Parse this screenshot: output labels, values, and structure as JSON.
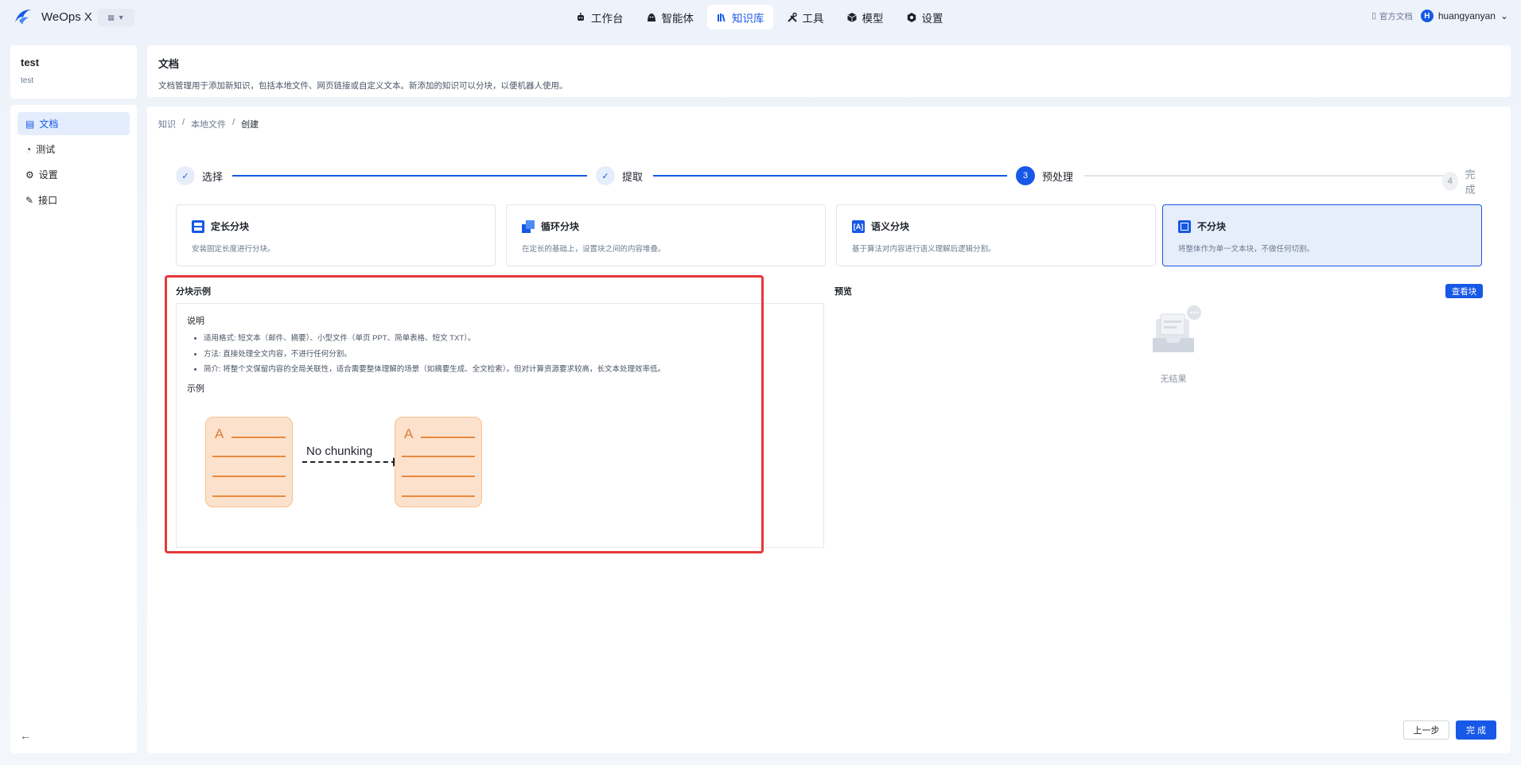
{
  "app": {
    "name": "WeOps X"
  },
  "nav": [
    {
      "label": "工作台",
      "icon": "robot-icon"
    },
    {
      "label": "智能体",
      "icon": "agent-icon"
    },
    {
      "label": "知识库",
      "icon": "library-icon",
      "active": true
    },
    {
      "label": "工具",
      "icon": "tools-icon"
    },
    {
      "label": "模型",
      "icon": "model-icon"
    },
    {
      "label": "设置",
      "icon": "gear-icon"
    }
  ],
  "topright": {
    "docs_label": "官方文档",
    "avatar_letter": "H",
    "username": "huangyanyan"
  },
  "sidebar": {
    "title": "test",
    "subtitle": "test",
    "items": [
      {
        "label": "文档",
        "icon": "document-icon",
        "active": true
      },
      {
        "label": "测试",
        "icon": "test-icon"
      },
      {
        "label": "设置",
        "icon": "settings-icon"
      },
      {
        "label": "接口",
        "icon": "api-icon"
      }
    ]
  },
  "header": {
    "title": "文档",
    "description": "文档管理用于添加新知识，包括本地文件、网页链接或自定义文本。新添加的知识可以分块，以便机器人使用。"
  },
  "breadcrumb": {
    "items": [
      "知识",
      "本地文件",
      "创建"
    ],
    "separator": "/"
  },
  "steps": [
    {
      "label": "选择",
      "status": "done"
    },
    {
      "label": "提取",
      "status": "done"
    },
    {
      "label": "预处理",
      "status": "current",
      "number": "3"
    },
    {
      "label": "完成",
      "status": "todo",
      "number": "4"
    }
  ],
  "methods": [
    {
      "title": "定长分块",
      "desc": "安装固定长度进行分块。"
    },
    {
      "title": "循环分块",
      "desc": "在定长的基础上，设置块之间的内容堆叠。"
    },
    {
      "title": "语义分块",
      "desc": "基于算法对内容进行语义理解后逻辑分割。"
    },
    {
      "title": "不分块",
      "desc": "将整体作为单一文本块，不做任何切割。",
      "selected": true
    }
  ],
  "example": {
    "title": "分块示例",
    "explain_heading": "说明",
    "bullets": [
      "适用格式: 短文本（邮件、摘要）、小型文件（单页 PPT、简单表格、短文 TXT）。",
      "方法: 直接处理全文内容，不进行任何分割。",
      "简介: 将整个文保留内容的全局关联性，适合需要整体理解的场景（如摘要生成、全文检索）。但对计算资源要求较高，长文本处理效率低。"
    ],
    "example_heading": "示例",
    "diagram_letter": "A",
    "diagram_label": "No chunking"
  },
  "preview": {
    "title": "预览",
    "view_button": "查看块",
    "empty_label": "无结果"
  },
  "footer": {
    "prev_label": "上一步",
    "done_label": "完 成"
  },
  "colors": {
    "primary": "#1758e6",
    "highlight": "#e5383b",
    "doc_fill": "#fce1cc",
    "doc_line": "#e88a3e"
  }
}
